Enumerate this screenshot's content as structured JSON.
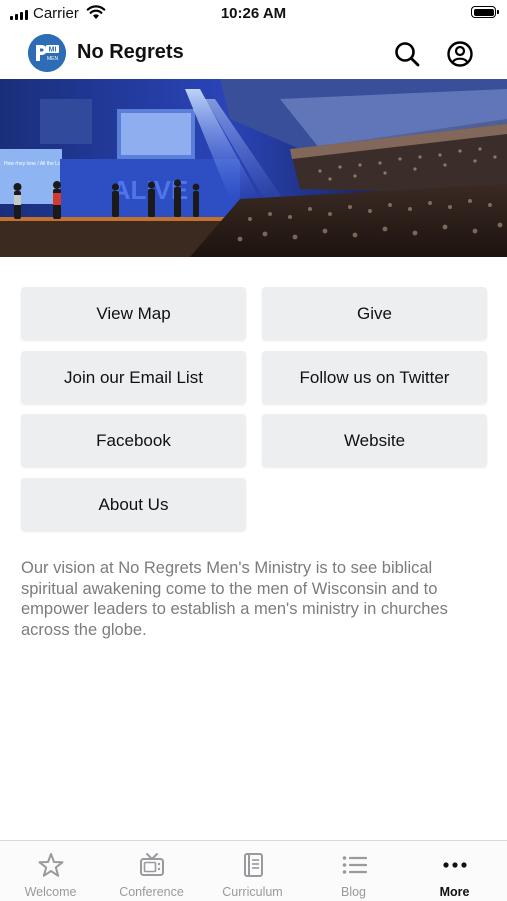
{
  "status_bar": {
    "carrier": "Carrier",
    "time": "10:26 AM"
  },
  "header": {
    "title": "No Regrets",
    "logo_text": "MI",
    "logo_sub": "MEN"
  },
  "banner": {
    "screen_text_left": "How rhey lone / All the Lord / Who lives for me",
    "screen_text_center": "ALIVE"
  },
  "buttons": [
    {
      "label": "View Map"
    },
    {
      "label": "Give"
    },
    {
      "label": "Join our Email List"
    },
    {
      "label": "Follow us on Twitter"
    },
    {
      "label": "Facebook"
    },
    {
      "label": "Website"
    },
    {
      "label": "About Us"
    }
  ],
  "vision_text": "Our vision at No Regrets Men's Ministry is to see biblical spiritual awakening come to the men of Wisconsin and to empower leaders to establish a men's ministry in churches across the globe.",
  "tabs": [
    {
      "label": "Welcome",
      "icon": "star-icon",
      "active": false
    },
    {
      "label": "Conference",
      "icon": "tv-icon",
      "active": false
    },
    {
      "label": "Curriculum",
      "icon": "book-icon",
      "active": false
    },
    {
      "label": "Blog",
      "icon": "list-icon",
      "active": false
    },
    {
      "label": "More",
      "icon": "more-icon",
      "active": true
    }
  ],
  "colors": {
    "accent": "#2d6db5",
    "button_bg": "#eceef0",
    "inactive_tab": "#9a9a9e",
    "body_text": "#7c7c80"
  }
}
